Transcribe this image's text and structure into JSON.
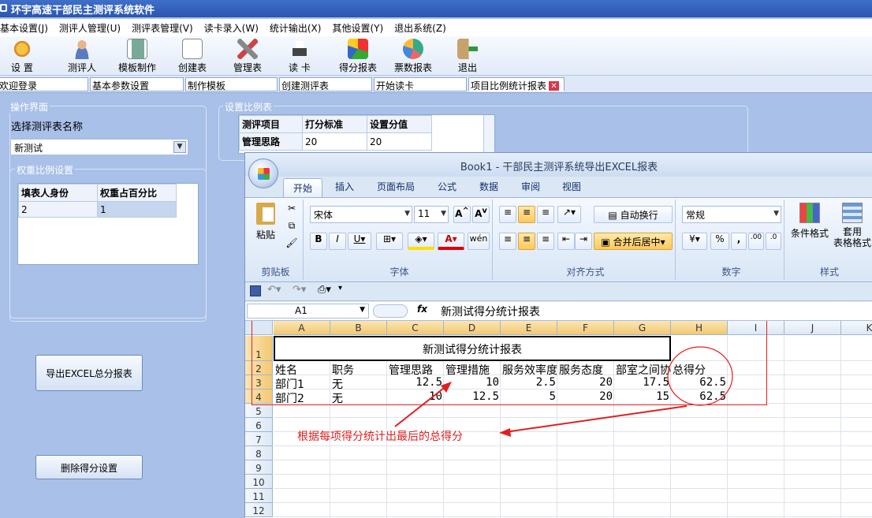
{
  "app": {
    "title": "环宇高速干部民主测评系统软件"
  },
  "menu": [
    "基本设置(J)",
    "测评人管理(U)",
    "测评表管理(V)",
    "读卡录入(W)",
    "统计输出(X)",
    "其他设置(Y)",
    "退出系统(Z)"
  ],
  "toolbar": [
    "设 置",
    "测评人",
    "模板制作",
    "创建表",
    "管理表",
    "读 卡",
    "得分报表",
    "票数报表",
    "退出"
  ],
  "tabs": [
    "欢迎登录",
    "基本参数设置",
    "制作模板",
    "创建测评表",
    "开始读卡",
    "项目比例统计报表"
  ],
  "left": {
    "group_title": "操作界面",
    "select_label": "选择测评表名称",
    "select_value": "新测试",
    "weight_title": "权重比例设置",
    "weight_headers": [
      "填表人身份",
      "权重占百分比"
    ],
    "weight_row": [
      "2",
      "1"
    ],
    "export_button": "导出EXCEL总分报表",
    "delete_button": "删除得分设置"
  },
  "ratio": {
    "group_title": "设置比例表",
    "headers": [
      "测评项目",
      "打分标准",
      "设置分值"
    ],
    "row": [
      "管理思路",
      "20",
      "20"
    ]
  },
  "excel": {
    "title": "Book1 - 干部民主测评系统导出EXCEL报表",
    "ribbon_tabs": [
      "开始",
      "插入",
      "页面布局",
      "公式",
      "数据",
      "审阅",
      "视图"
    ],
    "groups": {
      "clipboard": "剪贴板",
      "font": "字体",
      "align": "对齐方式",
      "number": "数字",
      "styles": "样式"
    },
    "paste": "粘贴",
    "font_name": "宋体",
    "font_size": "11",
    "wrap": "自动换行",
    "merge": "合并后居中",
    "number_format": "常规",
    "conditional": "条件格式",
    "table_format": [
      "套用",
      "表格格式"
    ],
    "percent": "%",
    "comma": ",",
    "inc_dec": ".00",
    "namebox": "A1",
    "fx": "fx",
    "formula": "新测试得分统计报表",
    "columns": [
      "A",
      "B",
      "C",
      "D",
      "E",
      "F",
      "G",
      "H",
      "I",
      "J",
      "K"
    ],
    "rows": [
      "1",
      "2",
      "3",
      "4",
      "5",
      "6",
      "7",
      "8",
      "9",
      "10",
      "11",
      "12"
    ],
    "sheet_title": "新测试得分统计报表",
    "header_row": [
      "姓名",
      "职务",
      "管理思路",
      "管理措施",
      "服务效率度",
      "服务态度",
      "部室之间协",
      "总得分"
    ],
    "data_rows": [
      [
        "部门1",
        "无",
        "12.5",
        "10",
        "2.5",
        "20",
        "17.5",
        "62.5"
      ],
      [
        "部门2",
        "无",
        "10",
        "12.5",
        "5",
        "20",
        "15",
        "62.5"
      ]
    ],
    "annotation": "根据每项得分统计出最后的总得分"
  }
}
